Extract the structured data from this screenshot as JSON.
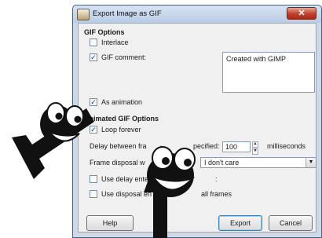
{
  "window": {
    "title": "Export Image as GIF",
    "close_label": "✕"
  },
  "gif_options": {
    "heading": "GIF Options",
    "interlace": {
      "label": "Interlace",
      "checked": false
    },
    "gif_comment": {
      "label": "GIF comment:",
      "checked": true,
      "value": "Created with GIMP"
    },
    "as_animation": {
      "label": "As animation",
      "checked": true
    }
  },
  "animated_options": {
    "heading": "Animated GIF Options",
    "loop_forever": {
      "label": "Loop forever",
      "checked": true
    },
    "delay": {
      "label_left": "Delay between fra",
      "label_right": "pecified:",
      "value": "100",
      "unit": "milliseconds"
    },
    "frame_disposal": {
      "label": "Frame disposal w",
      "value": "I don't care"
    },
    "use_delay": {
      "label": "Use delay ente",
      "trailing": ":",
      "checked": false
    },
    "use_disposal": {
      "label": "Use disposal en",
      "trailing": "all frames",
      "checked": false
    }
  },
  "buttons": {
    "help": "Help",
    "export": "Export",
    "cancel": "Cancel"
  },
  "colors": {
    "accent": "#3c7fb1",
    "titlebar": "#c7d6ea",
    "close": "#c5402a"
  }
}
